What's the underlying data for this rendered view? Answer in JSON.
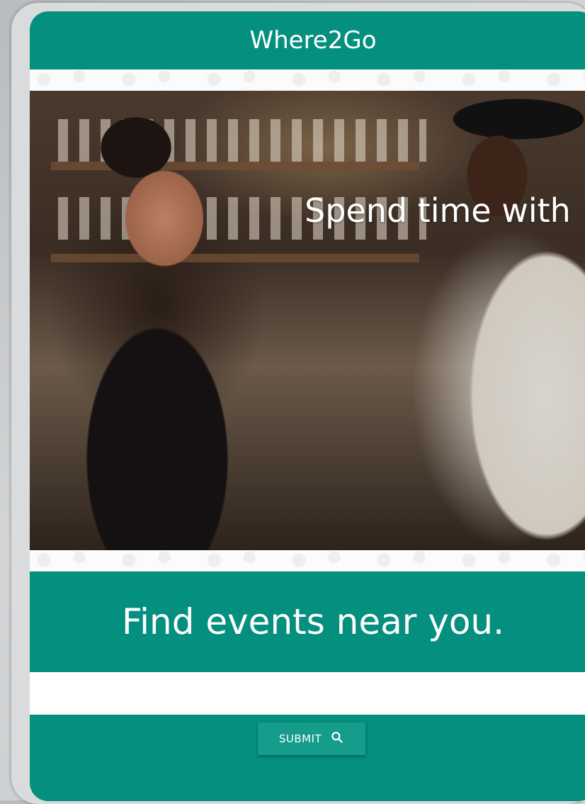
{
  "app": {
    "title": "Where2Go"
  },
  "hero": {
    "headline": "Spend time with"
  },
  "find": {
    "heading": "Find events near you."
  },
  "search": {
    "value": ""
  },
  "submit": {
    "label": "SUBMIT",
    "icon": "search-icon"
  },
  "colors": {
    "brand": "#058f7e",
    "button": "#159c8b"
  }
}
